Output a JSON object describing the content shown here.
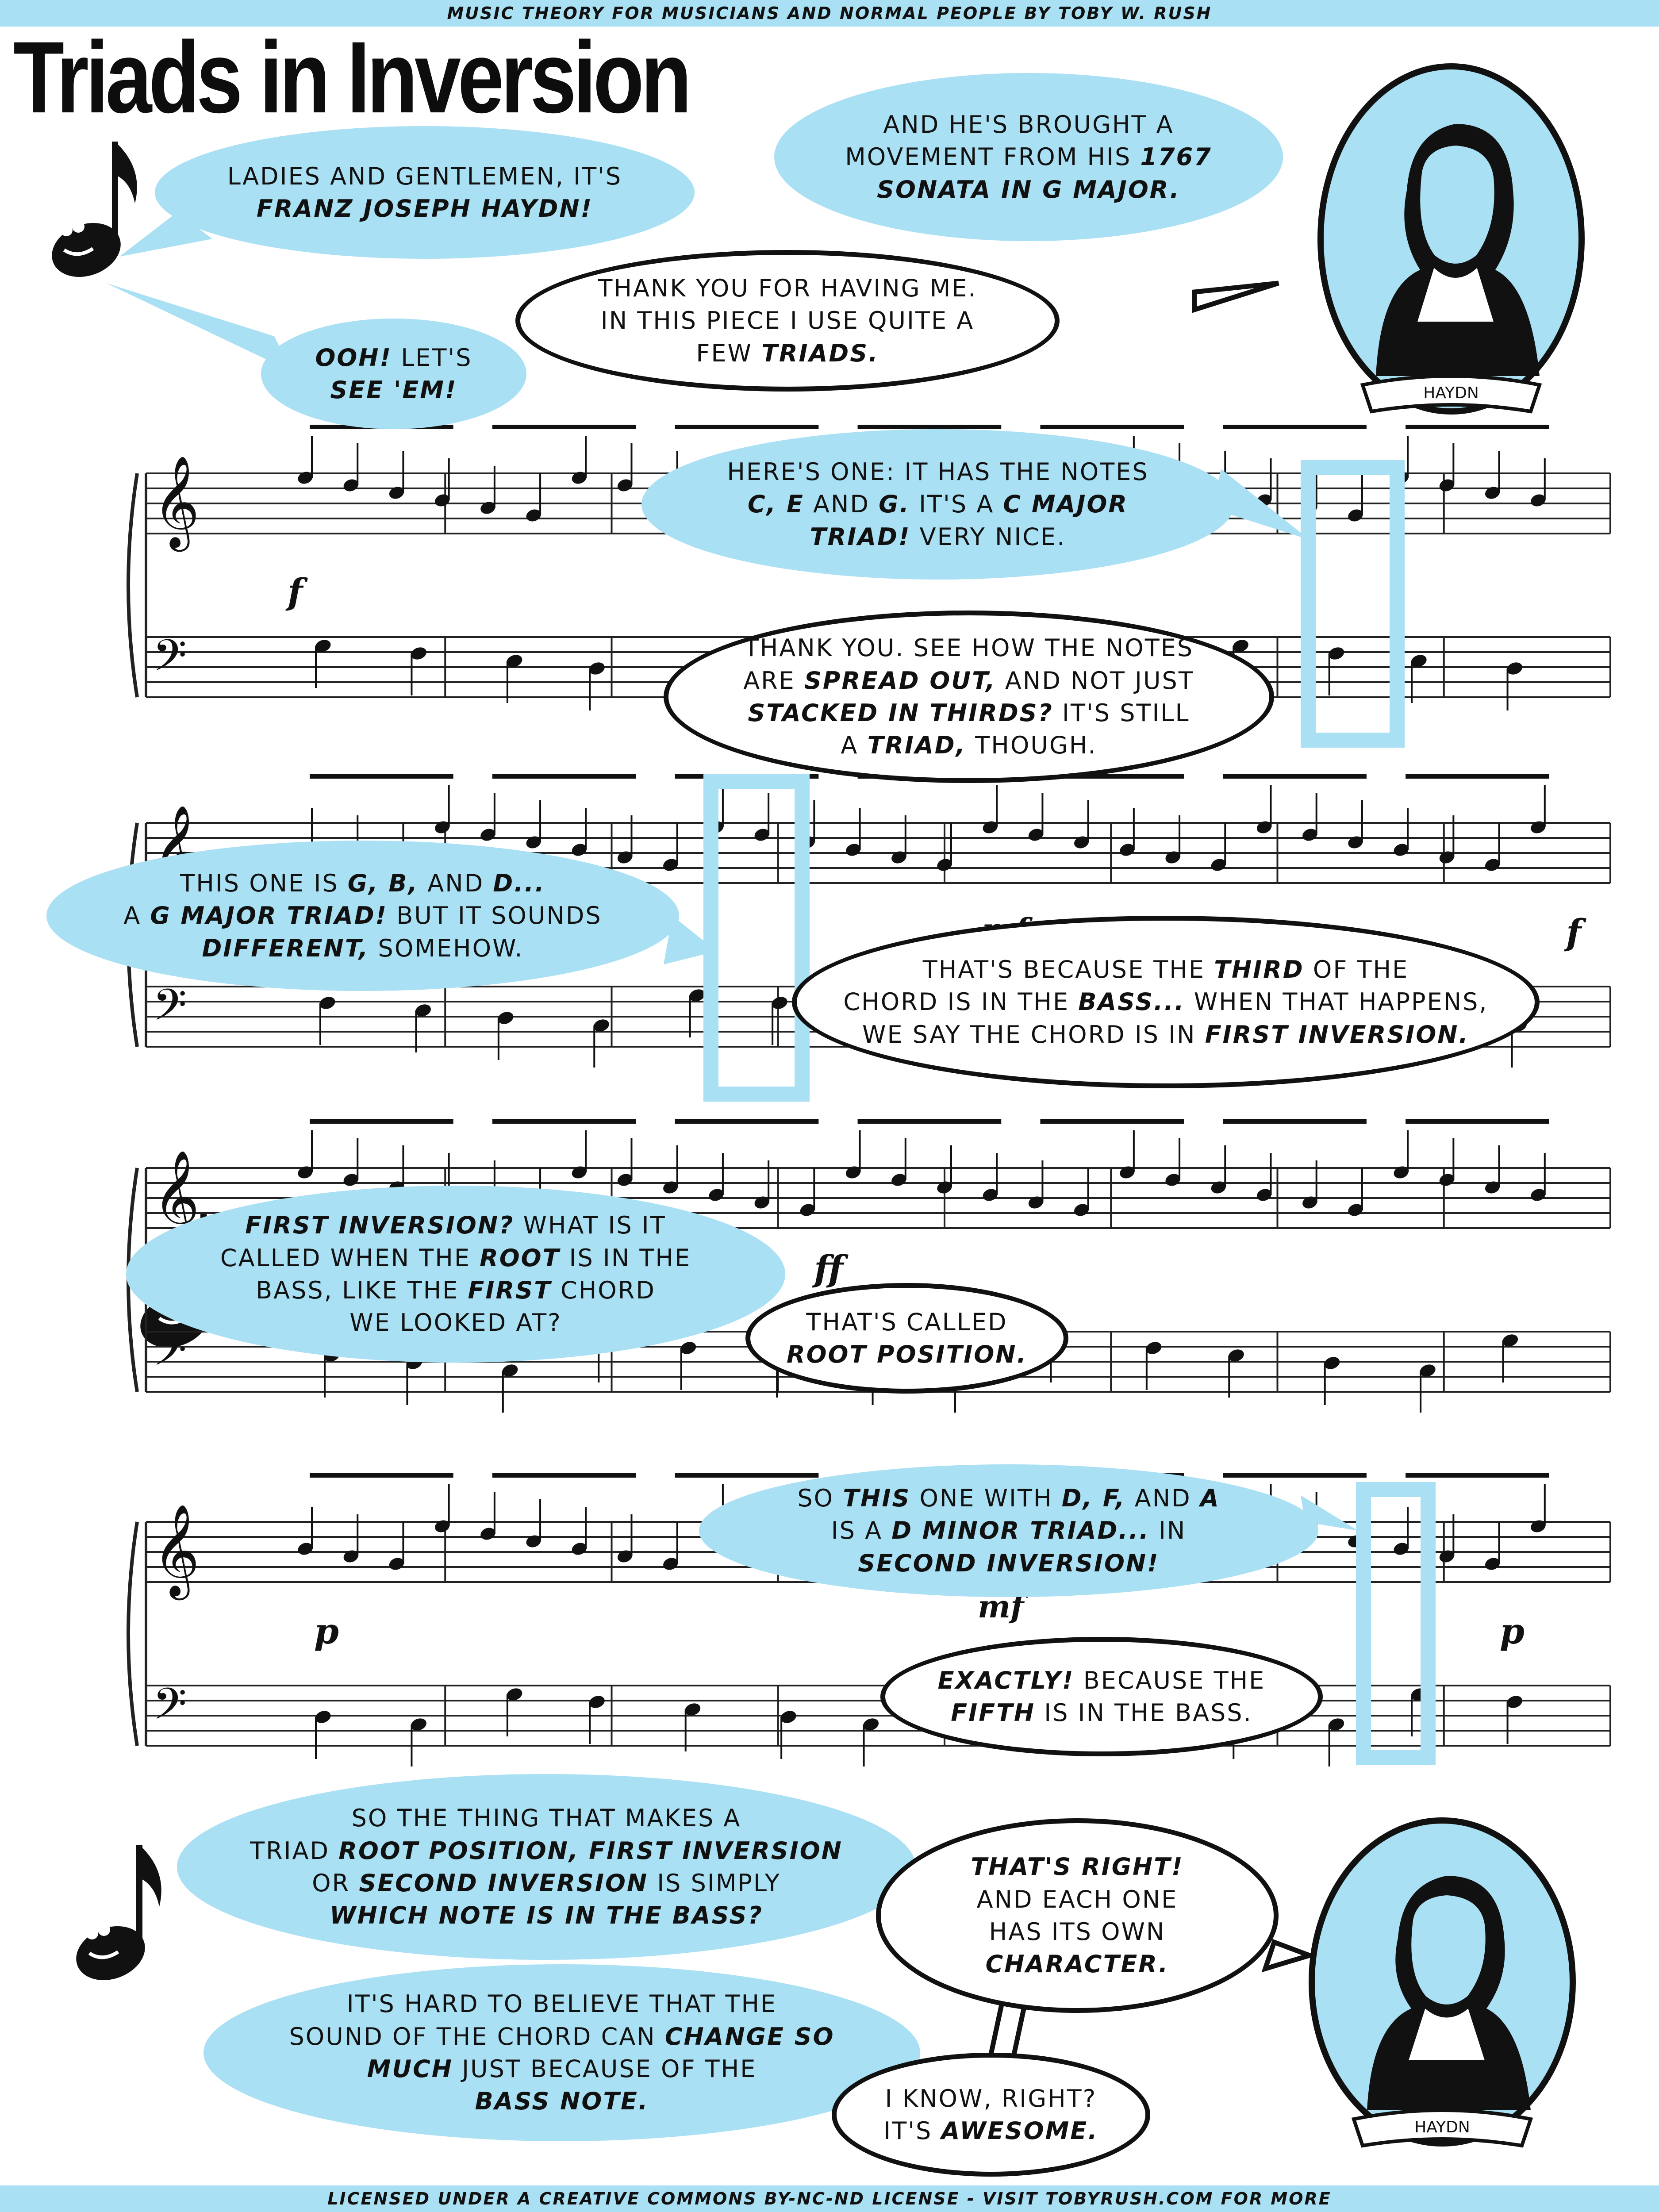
{
  "header": {
    "text": "MUSIC THEORY FOR MUSICIANS AND NORMAL PEOPLE BY TOBY W. RUSH"
  },
  "title": "Triads in Inversion",
  "footer": {
    "prefix": "LICENSED UNDER A ",
    "license": "CREATIVE COMMONS BY-NC-ND",
    "middle": " LICENSE - VISIT ",
    "site": "TOBYRUSH.COM",
    "suffix": " FOR MORE"
  },
  "portraits": {
    "top_label": "HAYDN",
    "bottom_label": "HAYDN"
  },
  "dynamics": {
    "f1": "f",
    "f2": "f",
    "mf1": "mf",
    "ff": "ff",
    "p1": "p",
    "mf2": "mf",
    "p2": "p"
  },
  "bubbles": {
    "b1": {
      "l1a": "LADIES AND GENTLEMEN, IT'S",
      "l2b": "FRANZ JOSEPH HAYDN!"
    },
    "b2": {
      "l1a": "AND HE'S BROUGHT A",
      "l2a": "MOVEMENT FROM HIS ",
      "l2b": "1767",
      "l3b": "SONATA IN G MAJOR."
    },
    "b3": {
      "l1a": "THANK YOU FOR HAVING ME.",
      "l2a": "IN THIS PIECE I USE QUITE A",
      "l3a": "FEW ",
      "l3b": "TRIADS."
    },
    "b4": {
      "l1b": "OOH!",
      "l1a": " LET'S",
      "l2b": "SEE 'EM!"
    },
    "b5": {
      "l1a": "HERE'S ONE: IT HAS THE NOTES",
      "l2b1": "C, E",
      "l2a": " AND ",
      "l2b2": "G.",
      "l2c": " IT'S A ",
      "l2b3": "C MAJOR",
      "l3b": "TRIAD!",
      "l3a": " VERY NICE."
    },
    "b6": {
      "l1a": "THANK YOU. SEE HOW THE NOTES",
      "l2a": "ARE ",
      "l2b": "SPREAD OUT,",
      "l2c": " AND NOT JUST",
      "l3b": "STACKED IN THIRDS?",
      "l3a": " IT'S STILL",
      "l4a": "A ",
      "l4b": "TRIAD,",
      "l4c": " THOUGH."
    },
    "b7": {
      "l1a": "THIS ONE IS ",
      "l1b": "G, B,",
      "l1c": " AND ",
      "l1d": "D...",
      "l2a": "A ",
      "l2b": "G MAJOR TRIAD!",
      "l2c": " BUT IT SOUNDS",
      "l3b": "DIFFERENT,",
      "l3a": " SOMEHOW."
    },
    "b8": {
      "l1a": "THAT'S BECAUSE THE ",
      "l1b": "THIRD",
      "l1c": " OF THE",
      "l2a": "CHORD IS IN THE ",
      "l2b": "BASS...",
      "l2c": " WHEN THAT HAPPENS,",
      "l3a": "WE SAY THE CHORD IS IN ",
      "l3b": "FIRST INVERSION."
    },
    "b9": {
      "l1b": "FIRST INVERSION?",
      "l1a": " WHAT IS IT",
      "l2a": "CALLED WHEN THE ",
      "l2b": "ROOT",
      "l2c": " IS IN THE",
      "l3a": "BASS, LIKE THE ",
      "l3b": "FIRST",
      "l3c": " CHORD",
      "l4a": "WE LOOKED AT?"
    },
    "b10": {
      "l1a": "THAT'S CALLED",
      "l2b": "ROOT POSITION."
    },
    "b11": {
      "l1a": "SO ",
      "l1b": "THIS",
      "l1c": " ONE WITH ",
      "l1d": "D, F,",
      "l1e": " AND ",
      "l1f": "A",
      "l2a": "IS A ",
      "l2b": "D MINOR TRIAD...",
      "l2c": " IN",
      "l3b": "SECOND INVERSION!"
    },
    "b12": {
      "l1b": "EXACTLY!",
      "l1a": " BECAUSE THE",
      "l2b": "FIFTH",
      "l2a": " IS IN THE BASS."
    },
    "b13": {
      "l1a": "SO THE THING THAT MAKES A",
      "l2a": "TRIAD ",
      "l2b": "ROOT POSITION, FIRST INVERSION",
      "l3a": "OR ",
      "l3b": "SECOND INVERSION",
      "l3c": " IS SIMPLY",
      "l4b": "WHICH NOTE IS IN THE BASS?"
    },
    "b14": {
      "l1b": "THAT'S RIGHT!",
      "l2a": "AND EACH ONE",
      "l3a": "HAS ITS OWN",
      "l4b": "CHARACTER."
    },
    "b15": {
      "l1a": "IT'S HARD TO BELIEVE THAT THE",
      "l2a": "SOUND OF THE CHORD CAN ",
      "l2b": "CHANGE SO",
      "l3b": "MUCH",
      "l3a": " JUST BECAUSE OF THE",
      "l4b": "BASS NOTE."
    },
    "b16": {
      "l1a": "I KNOW, RIGHT?",
      "l2a": "IT'S ",
      "l2b": "AWESOME."
    }
  },
  "colors": {
    "accent": "#a9e0f3",
    "ink": "#111111"
  },
  "icons": [
    "eighth-note-mascot-icon",
    "haydn-portrait-icon",
    "treble-clef-icon",
    "bass-clef-icon"
  ]
}
